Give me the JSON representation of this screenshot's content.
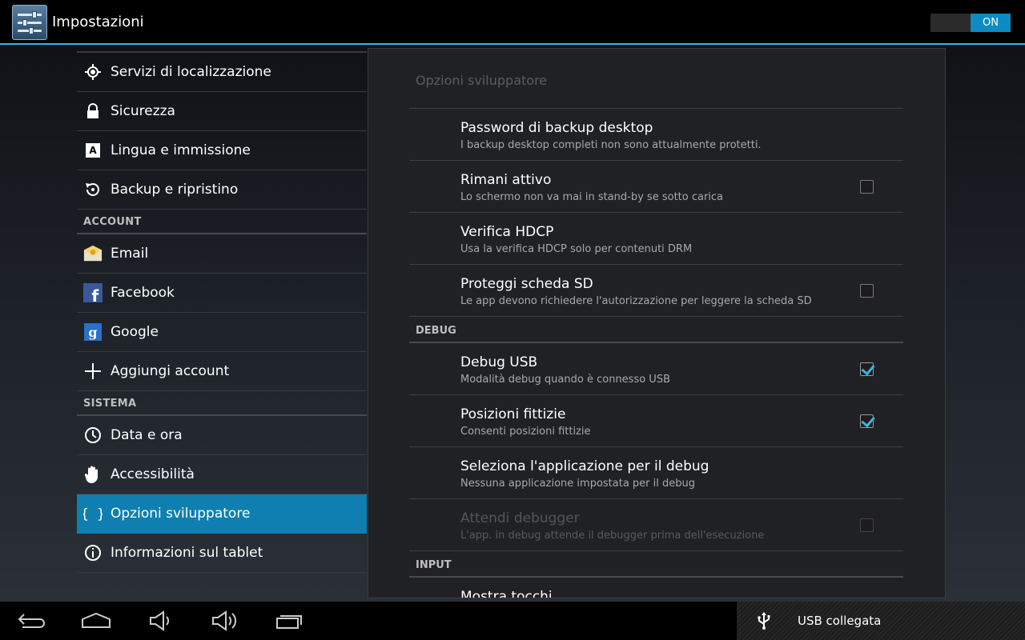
{
  "actionbar": {
    "title": "Impostazioni",
    "toggle_label": "ON"
  },
  "left": {
    "items_top": [
      {
        "label": "Servizi di localizzazione",
        "icon": "location-icon"
      },
      {
        "label": "Sicurezza",
        "icon": "lock-icon"
      },
      {
        "label": "Lingua e immissione",
        "icon": "keyboard-a-icon"
      },
      {
        "label": "Backup e ripristino",
        "icon": "restore-icon"
      }
    ],
    "account_header": "ACCOUNT",
    "items_account": [
      {
        "label": "Email",
        "icon": "email-icon"
      },
      {
        "label": "Facebook",
        "icon": "facebook-icon"
      },
      {
        "label": "Google",
        "icon": "google-icon"
      },
      {
        "label": "Aggiungi account",
        "icon": "plus-icon"
      }
    ],
    "system_header": "SISTEMA",
    "items_system": [
      {
        "label": "Data e ora",
        "icon": "clock-icon"
      },
      {
        "label": "Accessibilità",
        "icon": "hand-icon"
      },
      {
        "label": "Opzioni sviluppatore",
        "icon": "braces-icon"
      },
      {
        "label": "Informazioni sul tablet",
        "icon": "info-icon"
      }
    ]
  },
  "panel": {
    "title": "Opzioni sviluppatore",
    "prefs1": [
      {
        "title": "Password di backup desktop",
        "summary": "I backup desktop completi non sono attualmente protetti."
      },
      {
        "title": "Rimani attivo",
        "summary": "Lo schermo non va mai in stand-by se sotto carica"
      },
      {
        "title": "Verifica HDCP",
        "summary": "Usa la verifica HDCP solo per contenuti DRM"
      },
      {
        "title": "Proteggi scheda SD",
        "summary": "Le app devono richiedere l'autorizzazione per leggere la scheda SD"
      }
    ],
    "debug_header": "DEBUG",
    "prefs2": [
      {
        "title": "Debug USB",
        "summary": "Modalità debug quando è connesso USB"
      },
      {
        "title": "Posizioni fittizie",
        "summary": "Consenti posizioni fittizie"
      },
      {
        "title": "Seleziona l'applicazione per il debug",
        "summary": "Nessuna applicazione impostata per il debug"
      },
      {
        "title": "Attendi debugger",
        "summary": "L'app. in debug attende il debugger prima dell'esecuzione"
      }
    ],
    "input_header": "INPUT",
    "cut_off_title": "Mostra tocchi"
  },
  "status": {
    "text": "USB collegata"
  },
  "colors": {
    "accent": "#33b5e5",
    "selected": "#0e7fb0",
    "toggle_on": "#0e8bc2"
  }
}
